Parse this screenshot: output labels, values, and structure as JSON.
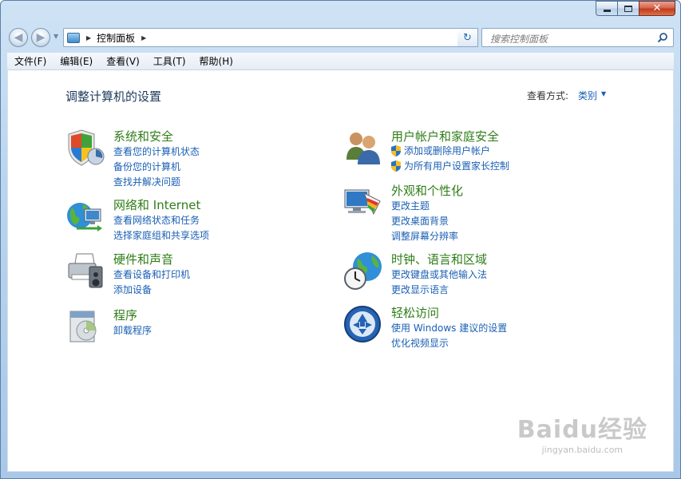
{
  "address": {
    "crumb": "控制面板"
  },
  "search": {
    "placeholder": "搜索控制面板"
  },
  "menu": [
    "文件(F)",
    "编辑(E)",
    "查看(V)",
    "工具(T)",
    "帮助(H)"
  ],
  "main": {
    "title": "调整计算机的设置",
    "view_by_label": "查看方式:",
    "view_by_value": "类别"
  },
  "categories": {
    "system": {
      "title": "系统和安全",
      "icon": "security-shield-icon",
      "links": [
        "查看您的计算机状态",
        "备份您的计算机",
        "查找并解决问题"
      ]
    },
    "network": {
      "title": "网络和 Internet",
      "icon": "network-globe-icon",
      "links": [
        "查看网络状态和任务",
        "选择家庭组和共享选项"
      ]
    },
    "hardware": {
      "title": "硬件和声音",
      "icon": "printer-speaker-icon",
      "links": [
        "查看设备和打印机",
        "添加设备"
      ]
    },
    "programs": {
      "title": "程序",
      "icon": "programs-box-icon",
      "links": [
        "卸载程序"
      ]
    },
    "users": {
      "title": "用户帐户和家庭安全",
      "icon": "users-icon",
      "links": [
        "添加或删除用户帐户",
        "为所有用户设置家长控制"
      ]
    },
    "appearance": {
      "title": "外观和个性化",
      "icon": "monitor-palette-icon",
      "links": [
        "更改主题",
        "更改桌面背景",
        "调整屏幕分辨率"
      ]
    },
    "clock": {
      "title": "时钟、语言和区域",
      "icon": "clock-globe-icon",
      "links": [
        "更改键盘或其他输入法",
        "更改显示语言"
      ]
    },
    "ease": {
      "title": "轻松访问",
      "icon": "ease-of-access-icon",
      "links": [
        "使用 Windows 建议的设置",
        "优化视频显示"
      ]
    }
  },
  "watermark": {
    "logo": "Baidu经验",
    "url": "jingyan.baidu.com"
  }
}
